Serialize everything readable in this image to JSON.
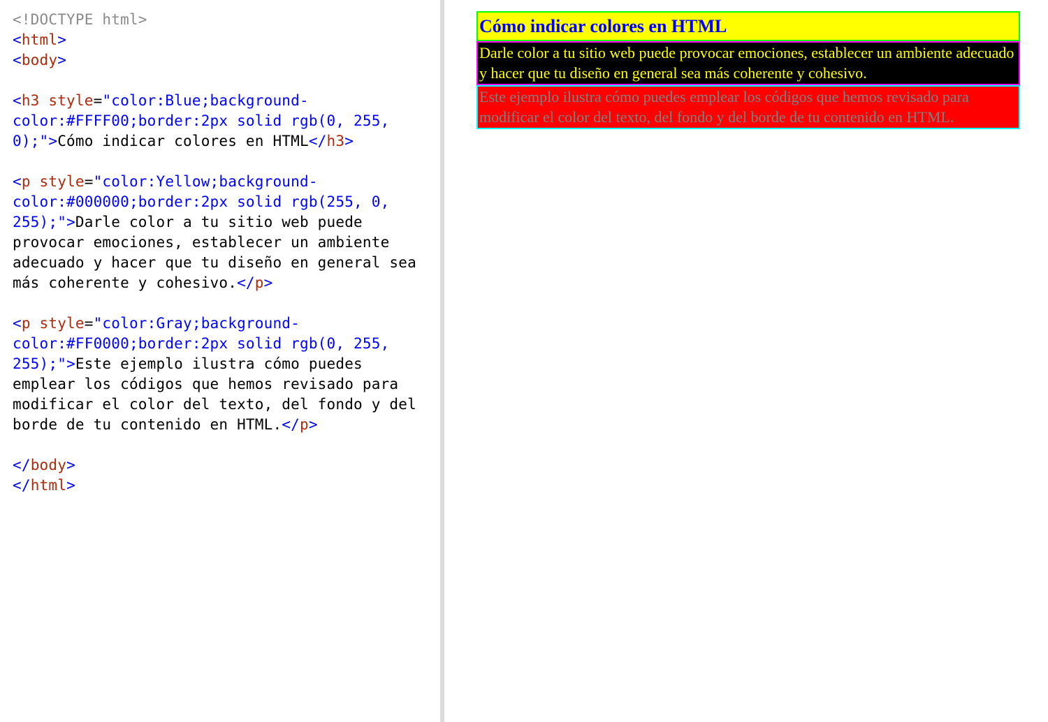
{
  "code": {
    "l1": "<!DOCTYPE html>",
    "l2_open": "<",
    "l2_tag": "html",
    "l2_close": ">",
    "l3_open": "<",
    "l3_tag": "body",
    "l3_close": ">",
    "h3_open": "<",
    "h3_tag": "h3",
    "h3_sp": " ",
    "h3_attr": "style",
    "h3_eq": "=",
    "h3_str": "\"color:Blue;background-color:#FFFF00;border:2px solid rgb(0, 255, 0);\"",
    "h3_gt": ">",
    "h3_text": "Cómo indicar colores en HTML",
    "h3_ctag_o": "</",
    "h3_ctag": "h3",
    "h3_ctag_c": ">",
    "p1_open": "<",
    "p1_tag": "p",
    "p1_sp": " ",
    "p1_attr": "style",
    "p1_eq": "=",
    "p1_str": "\"color:Yellow;background-color:#000000;border:2px solid rgb(255, 0, 255);\"",
    "p1_gt": ">",
    "p1_text": "Darle color a tu sitio web puede provocar emociones, establecer un ambiente adecuado y hacer que tu diseño en general sea más coherente y cohesivo.",
    "p1_ctag_o": "</",
    "p1_ctag": "p",
    "p1_ctag_c": ">",
    "p2_open": "<",
    "p2_tag": "p",
    "p2_sp": " ",
    "p2_attr": "style",
    "p2_eq": "=",
    "p2_str": "\"color:Gray;background-color:#FF0000;border:2px solid rgb(0, 255, 255);\"",
    "p2_gt": ">",
    "p2_text": "Este ejemplo ilustra cómo puedes emplear los códigos que hemos revisado para modificar el color del texto, del fondo y del borde de tu contenido en HTML.",
    "p2_ctag_o": "</",
    "p2_ctag": "p",
    "p2_ctag_c": ">",
    "body_c_o": "</",
    "body_c_t": "body",
    "body_c_c": ">",
    "html_c_o": "</",
    "html_c_t": "html",
    "html_c_c": ">"
  },
  "render": {
    "h3": {
      "text": "Cómo indicar colores en HTML",
      "color": "Blue",
      "bg": "#FFFF00",
      "border": "2px solid rgb(0, 255, 0)"
    },
    "p1": {
      "text": "Darle color a tu sitio web puede provocar emociones, establecer un ambiente adecuado y hacer que tu diseño en general sea más coherente y cohesivo.",
      "color": "Yellow",
      "bg": "#000000",
      "border": "2px solid rgb(255, 0, 255)"
    },
    "p2": {
      "text": "Este ejemplo ilustra cómo puedes emplear los códigos que hemos revisado para modificar el color del texto, del fondo y del borde de tu contenido en HTML.",
      "color": "Gray",
      "bg": "#FF0000",
      "border": "2px solid rgb(0, 255, 255)"
    }
  }
}
